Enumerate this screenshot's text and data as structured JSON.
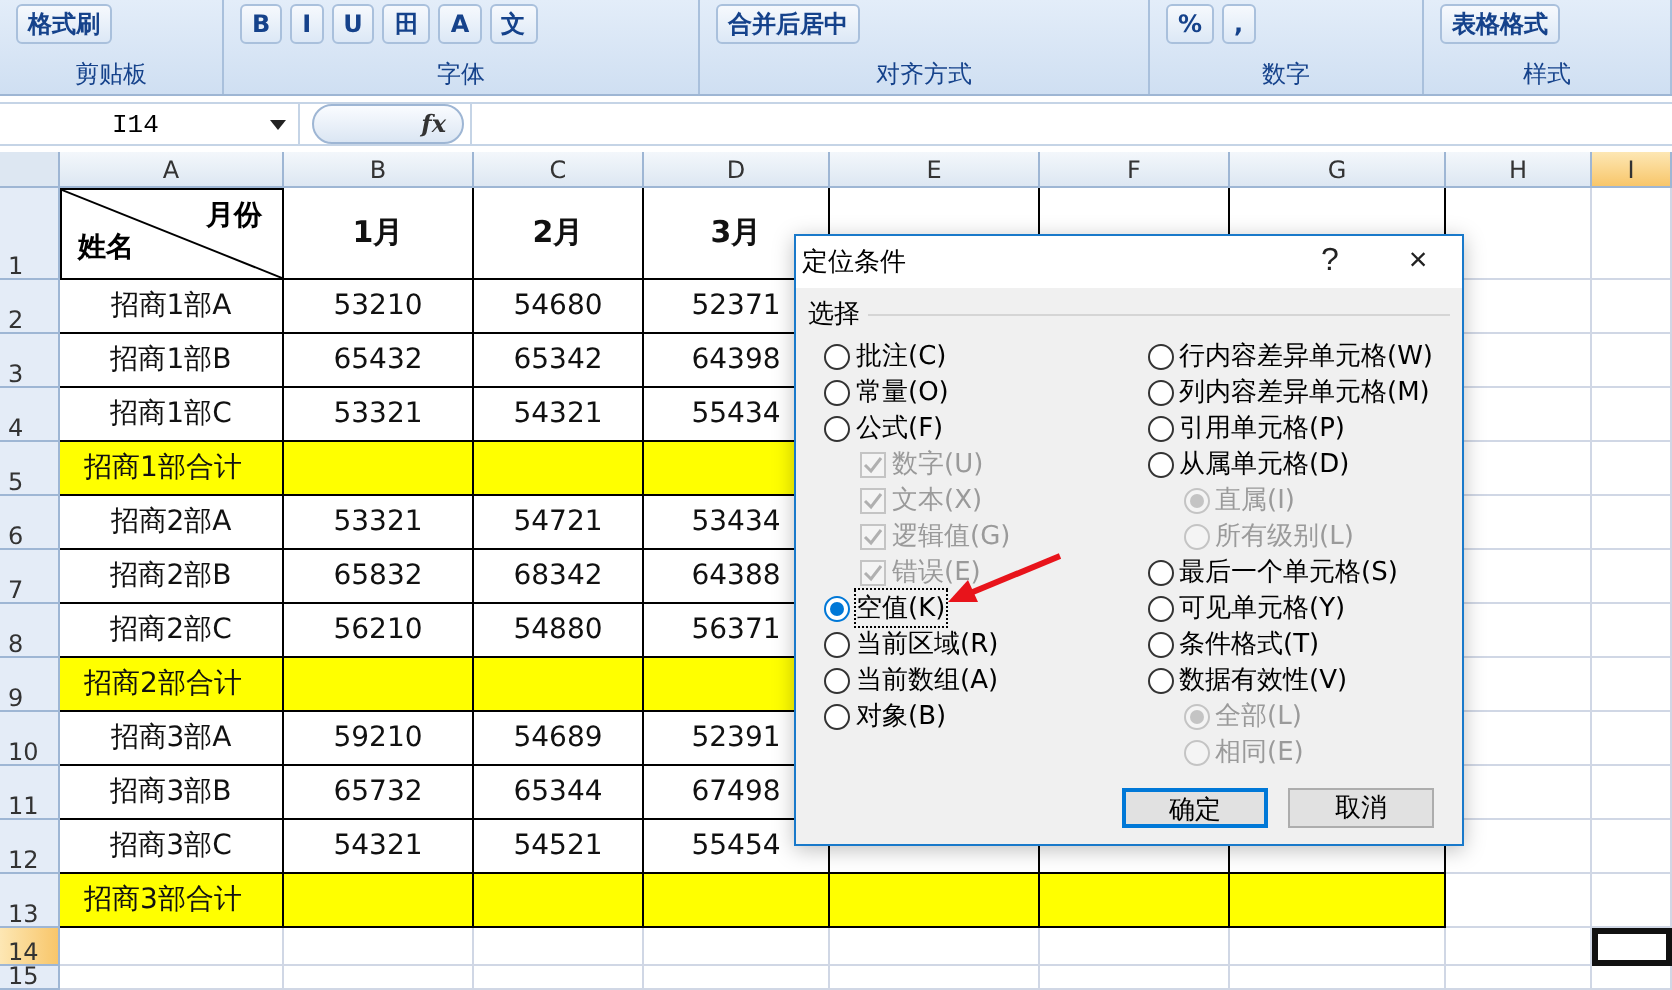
{
  "ribbon": {
    "groups": [
      {
        "label": "剪贴板",
        "buttons": [
          "格式刷"
        ]
      },
      {
        "label": "字体",
        "buttons": [
          "B",
          "I",
          "U",
          "田",
          "A",
          "文"
        ]
      },
      {
        "label": "对齐方式",
        "buttons": [
          "合并后居中"
        ]
      },
      {
        "label": "数字",
        "buttons": [
          "%",
          ","
        ]
      },
      {
        "label": "样式",
        "buttons": [
          "表格格式"
        ]
      }
    ]
  },
  "formula_bar": {
    "name_box": "I14",
    "fx": "fx"
  },
  "sheet": {
    "columns": [
      {
        "label": "A",
        "selected": false
      },
      {
        "label": "B",
        "selected": false
      },
      {
        "label": "C",
        "selected": false
      },
      {
        "label": "D",
        "selected": false
      },
      {
        "label": "E",
        "selected": false
      },
      {
        "label": "F",
        "selected": false
      },
      {
        "label": "G",
        "selected": false
      },
      {
        "label": "H",
        "selected": false
      },
      {
        "label": "I",
        "selected": true
      }
    ],
    "corner_header": {
      "top": "月份",
      "bottom": "姓名"
    },
    "rows": [
      {
        "number": "1",
        "selected": false,
        "highlighted": false,
        "cells": [
          "",
          "1月",
          "2月",
          "3月"
        ]
      },
      {
        "number": "2",
        "selected": false,
        "highlighted": false,
        "cells": [
          "招商1部A",
          "53210",
          "54680",
          "52371"
        ]
      },
      {
        "number": "3",
        "selected": false,
        "highlighted": false,
        "cells": [
          "招商1部B",
          "65432",
          "65342",
          "64398"
        ]
      },
      {
        "number": "4",
        "selected": false,
        "highlighted": false,
        "cells": [
          "招商1部C",
          "53321",
          "54321",
          "55434"
        ]
      },
      {
        "number": "5",
        "selected": false,
        "highlighted": true,
        "cells": [
          "招商1部合计"
        ]
      },
      {
        "number": "6",
        "selected": false,
        "highlighted": false,
        "cells": [
          "招商2部A",
          "53321",
          "54721",
          "53434"
        ]
      },
      {
        "number": "7",
        "selected": false,
        "highlighted": false,
        "cells": [
          "招商2部B",
          "65832",
          "68342",
          "64388"
        ]
      },
      {
        "number": "8",
        "selected": false,
        "highlighted": false,
        "cells": [
          "招商2部C",
          "56210",
          "54880",
          "56371"
        ]
      },
      {
        "number": "9",
        "selected": false,
        "highlighted": true,
        "cells": [
          "招商2部合计"
        ]
      },
      {
        "number": "10",
        "selected": false,
        "highlighted": false,
        "cells": [
          "招商3部A",
          "59210",
          "54689",
          "52391"
        ]
      },
      {
        "number": "11",
        "selected": false,
        "highlighted": false,
        "cells": [
          "招商3部B",
          "65732",
          "65344",
          "67498"
        ]
      },
      {
        "number": "12",
        "selected": false,
        "highlighted": false,
        "cells": [
          "招商3部C",
          "54321",
          "54521",
          "55454"
        ]
      },
      {
        "number": "13",
        "selected": false,
        "highlighted": true,
        "cells": [
          "招商3部合计"
        ]
      },
      {
        "number": "14",
        "selected": true,
        "highlighted": false,
        "cells": []
      },
      {
        "number": "15",
        "selected": false,
        "highlighted": false,
        "cells": []
      }
    ]
  },
  "dialog": {
    "title": "定位条件",
    "help": "?",
    "close": "×",
    "group_label": "选择",
    "left_options": [
      {
        "label": "批注(C)",
        "kind": "radio",
        "selected": false,
        "disabled": false,
        "focused": false
      },
      {
        "label": "常量(O)",
        "kind": "radio",
        "selected": false,
        "disabled": false,
        "focused": false
      },
      {
        "label": "公式(F)",
        "kind": "radio",
        "selected": false,
        "disabled": false,
        "focused": false,
        "children": [
          {
            "label": "数字(U)",
            "kind": "checkbox",
            "checked": true,
            "disabled": true,
            "focused": false
          },
          {
            "label": "文本(X)",
            "kind": "checkbox",
            "checked": true,
            "disabled": true,
            "focused": false
          },
          {
            "label": "逻辑值(G)",
            "kind": "checkbox",
            "checked": true,
            "disabled": true,
            "focused": false
          },
          {
            "label": "错误(E)",
            "kind": "checkbox",
            "checked": true,
            "disabled": true,
            "focused": false
          }
        ]
      },
      {
        "label": "空值(K)",
        "kind": "radio",
        "selected": true,
        "disabled": false,
        "focused": true
      },
      {
        "label": "当前区域(R)",
        "kind": "radio",
        "selected": false,
        "disabled": false,
        "focused": false
      },
      {
        "label": "当前数组(A)",
        "kind": "radio",
        "selected": false,
        "disabled": false,
        "focused": false
      },
      {
        "label": "对象(B)",
        "kind": "radio",
        "selected": false,
        "disabled": false,
        "focused": false
      }
    ],
    "right_options": [
      {
        "label": "行内容差异单元格(W)",
        "kind": "radio",
        "selected": false,
        "disabled": false,
        "focused": false
      },
      {
        "label": "列内容差异单元格(M)",
        "kind": "radio",
        "selected": false,
        "disabled": false,
        "focused": false
      },
      {
        "label": "引用单元格(P)",
        "kind": "radio",
        "selected": false,
        "disabled": false,
        "focused": false
      },
      {
        "label": "从属单元格(D)",
        "kind": "radio",
        "selected": false,
        "disabled": false,
        "focused": false,
        "children": [
          {
            "label": "直属(I)",
            "kind": "radio",
            "selected": true,
            "disabled": true,
            "focused": false
          },
          {
            "label": "所有级别(L)",
            "kind": "radio",
            "selected": false,
            "disabled": true,
            "focused": false
          }
        ]
      },
      {
        "label": "最后一个单元格(S)",
        "kind": "radio",
        "selected": false,
        "disabled": false,
        "focused": false
      },
      {
        "label": "可见单元格(Y)",
        "kind": "radio",
        "selected": false,
        "disabled": false,
        "focused": false
      },
      {
        "label": "条件格式(T)",
        "kind": "radio",
        "selected": false,
        "disabled": false,
        "focused": false
      },
      {
        "label": "数据有效性(V)",
        "kind": "radio",
        "selected": false,
        "disabled": false,
        "focused": false,
        "children": [
          {
            "label": "全部(L)",
            "kind": "radio",
            "selected": true,
            "disabled": true,
            "focused": false
          },
          {
            "label": "相同(E)",
            "kind": "radio",
            "selected": false,
            "disabled": true,
            "focused": false
          }
        ]
      }
    ],
    "buttons": [
      {
        "label": "确定",
        "default": true
      },
      {
        "label": "取消",
        "default": false
      }
    ]
  }
}
